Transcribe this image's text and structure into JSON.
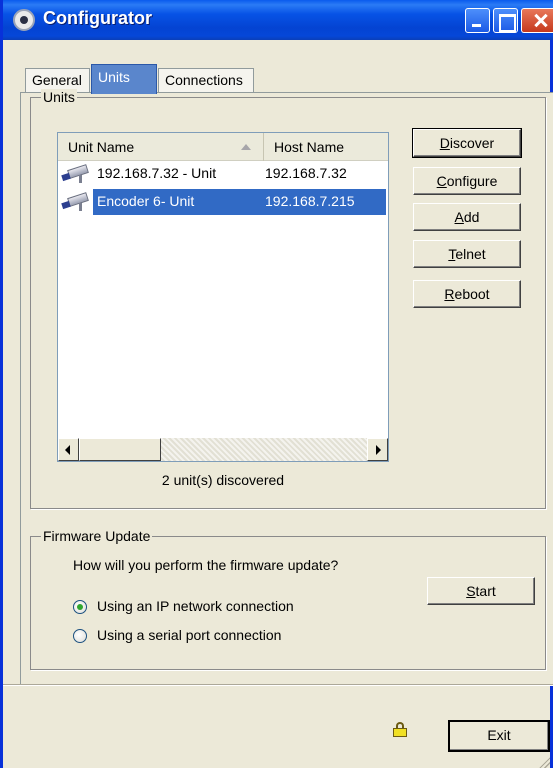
{
  "window": {
    "title": "Configurator"
  },
  "tabs": [
    {
      "label": "General"
    },
    {
      "label": "Units",
      "selected": true
    },
    {
      "label": "Connections"
    }
  ],
  "units_group": {
    "legend": "Units",
    "columns": [
      "Unit Name",
      "Host Name"
    ],
    "rows": [
      {
        "name": "192.168.7.32 - Unit",
        "host": "192.168.7.32",
        "icon": "camera-icon",
        "selected": false
      },
      {
        "name": "Encoder 6- Unit",
        "host": "192.168.7.215",
        "icon": "camera-icon",
        "selected": true
      }
    ],
    "status": "2 unit(s) discovered",
    "buttons": {
      "discover": {
        "mnemonic": "D",
        "rest": "iscover"
      },
      "configure": {
        "mnemonic": "C",
        "rest": "onfigure"
      },
      "add": {
        "mnemonic": "A",
        "rest": "dd"
      },
      "telnet": {
        "mnemonic": "T",
        "rest": "elnet"
      },
      "reboot": {
        "mnemonic": "R",
        "rest": "eboot"
      }
    }
  },
  "firmware_group": {
    "legend": "Firmware Update",
    "question": "How will you perform the firmware update?",
    "options": [
      {
        "label": "Using an IP network connection",
        "checked": true
      },
      {
        "label": "Using a serial port connection",
        "checked": false
      }
    ],
    "start": {
      "mnemonic": "S",
      "rest": "tart"
    }
  },
  "footer": {
    "exit_label": "Exit",
    "status_icon": "lock-icon"
  },
  "colors": {
    "titlebar": "#0753e6",
    "selection": "#316ac5",
    "tab_selected": "#5a86cc"
  }
}
